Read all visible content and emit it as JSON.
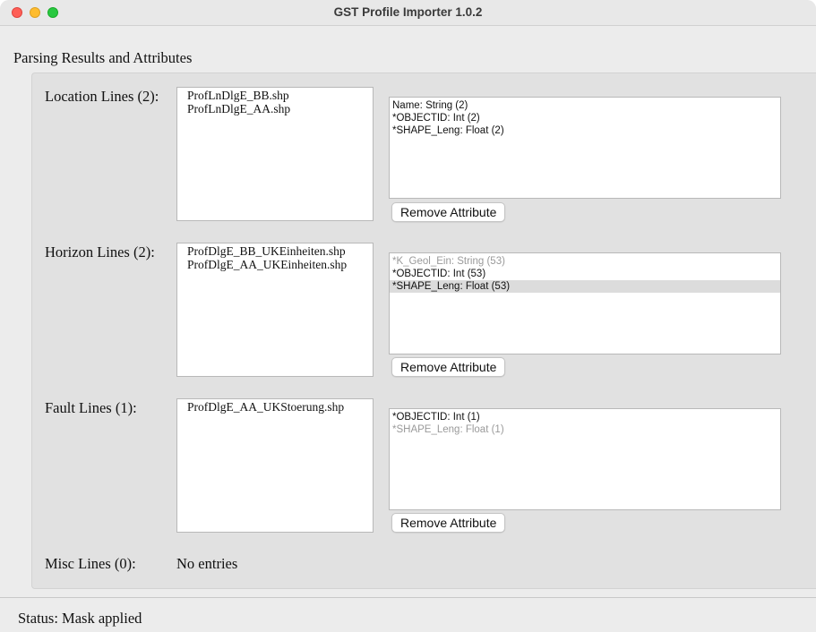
{
  "window": {
    "title": "GST Profile Importer 1.0.2"
  },
  "section": {
    "title": "Parsing Results and Attributes"
  },
  "rows": [
    {
      "label": "Location Lines (2):",
      "files": [
        "ProfLnDlgE_BB.shp",
        "ProfLnDlgE_AA.shp"
      ],
      "attributes": [
        {
          "text": "Name: String (2)",
          "state": "normal"
        },
        {
          "text": "*OBJECTID: Int (2)",
          "state": "normal"
        },
        {
          "text": "*SHAPE_Leng: Float (2)",
          "state": "normal"
        }
      ],
      "button_label": "Remove Attribute"
    },
    {
      "label": "Horizon Lines (2):",
      "files": [
        "ProfDlgE_BB_UKEinheiten.shp",
        "ProfDlgE_AA_UKEinheiten.shp"
      ],
      "attributes": [
        {
          "text": "*K_Geol_Ein: String (53)",
          "state": "disabled"
        },
        {
          "text": "*OBJECTID: Int (53)",
          "state": "normal"
        },
        {
          "text": "*SHAPE_Leng: Float (53)",
          "state": "selected"
        }
      ],
      "button_label": "Remove Attribute"
    },
    {
      "label": "Fault Lines (1):",
      "files": [
        "ProfDlgE_AA_UKStoerung.shp"
      ],
      "attributes": [
        {
          "text": "*OBJECTID: Int (1)",
          "state": "normal"
        },
        {
          "text": "*SHAPE_Leng: Float (1)",
          "state": "disabled"
        }
      ],
      "button_label": "Remove Attribute"
    }
  ],
  "misc": {
    "label": "Misc Lines (0):",
    "value": "No entries"
  },
  "status": {
    "text": "Status: Mask applied"
  },
  "colors": {
    "window_bg": "#ececec",
    "group_bg": "#e1e1e1",
    "selected_row": "#dcdcdc",
    "disabled_text": "#9a9a9a",
    "traffic_red": "#fe5f57",
    "traffic_yellow": "#febc2e",
    "traffic_green": "#28c840"
  }
}
